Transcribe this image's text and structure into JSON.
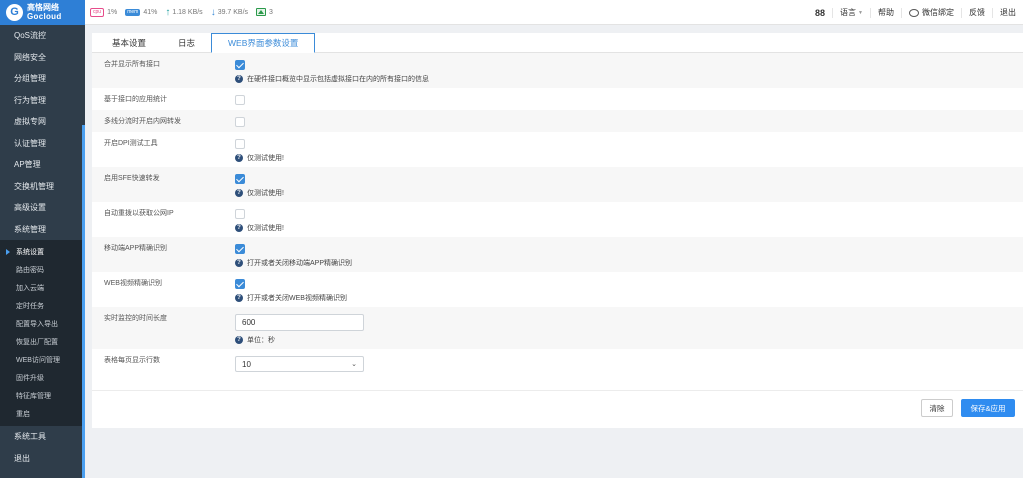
{
  "header": {
    "logo_cn": "高恪网络",
    "logo_en": "Gocloud",
    "cpu_chip": "cpu",
    "cpu": "1%",
    "mem_chip": "mem",
    "mem": "41%",
    "upload": "1.18 KB/s",
    "download": "39.7 KB/s",
    "online_count": "3",
    "user_count": "88",
    "language": "语言",
    "help": "帮助",
    "wechat_bind": "微信绑定",
    "feedback": "反馈",
    "logout": "退出"
  },
  "sidebar": {
    "items_top": [
      "QoS流控",
      "网络安全",
      "分组管理",
      "行为管理",
      "虚拟专网",
      "认证管理",
      "AP管理",
      "交换机管理",
      "高级设置",
      "系统管理"
    ],
    "sub_items": [
      "系统设置",
      "路由密码",
      "加入云端",
      "定时任务",
      "配置导入导出",
      "恢复出厂配置",
      "WEB访问管理",
      "固件升级",
      "特征库管理",
      "重启"
    ],
    "items_bottom": [
      "系统工具",
      "退出"
    ]
  },
  "tabs": [
    "基本设置",
    "日志",
    "WEB界面参数设置"
  ],
  "form": {
    "merge_label": "合并显示所有接口",
    "merge_hint": "在硬件接口概览中显示包括虚拟接口在内的所有接口的信息",
    "iface_stats_label": "基于接口的应用统计",
    "multiline_label": "多线分流时开启内网转发",
    "dpi_label": "开启DPI测试工具",
    "dpi_hint": "仅测试使用!",
    "sfe_label": "启用SFE快速转发",
    "sfe_hint": "仅测试使用!",
    "redial_label": "自动重拨以获取公网IP",
    "redial_hint": "仅测试使用!",
    "mobile_app_label": "移动端APP精确识别",
    "mobile_app_hint": "打开或者关闭移动端APP精确识别",
    "web_video_label": "WEB视频精确识别",
    "web_video_hint": "打开或者关闭WEB视频精确识别",
    "monitor_label": "实时监控的时间长度",
    "monitor_value": "600",
    "monitor_hint": "单位：秒",
    "rows_label": "表格每页显示行数",
    "rows_value": "10"
  },
  "buttons": {
    "clear": "清除",
    "save": "保存&应用"
  }
}
